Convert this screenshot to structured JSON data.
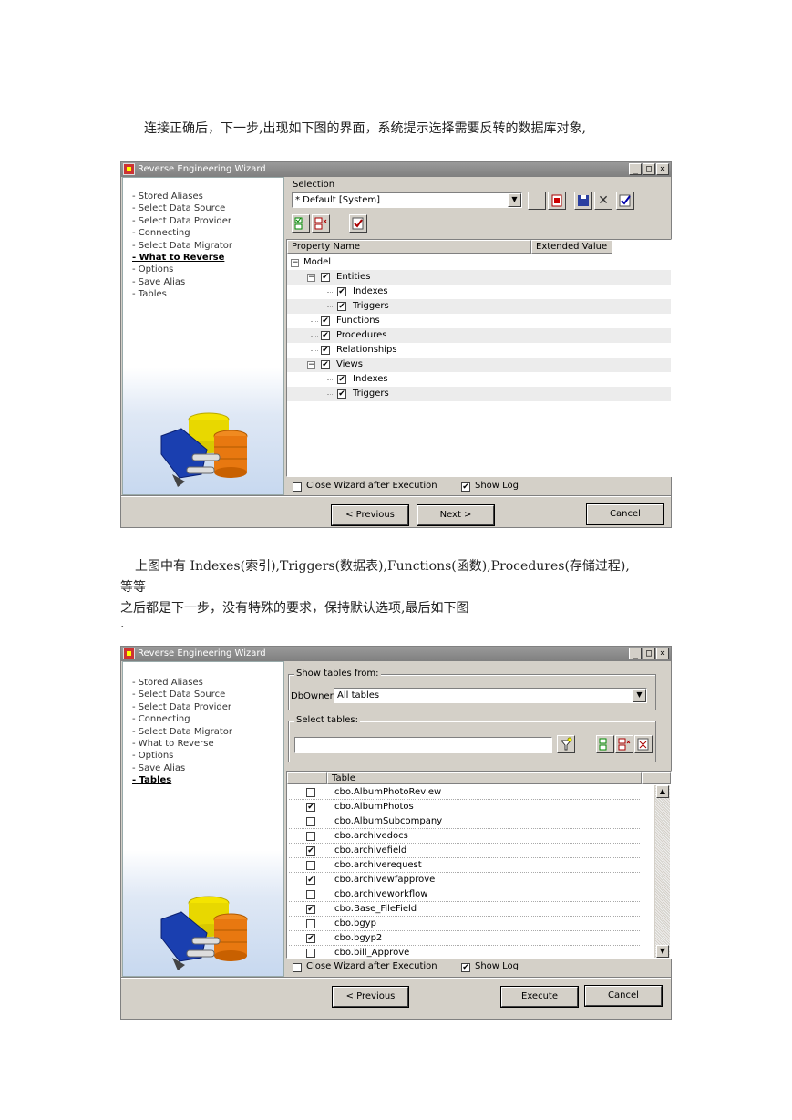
{
  "doc": {
    "para1": "连接正确后，下一步,出现如下图的界面，系统提示选择需要反转的数据库对象,",
    "para2_line1": "上图中有 Indexes(索引),Triggers(数据表),Functions(函数),Procedures(存储过程),",
    "para2_line2": "等等",
    "para3": "之后都是下一步，没有特殊的要求，保持默认选项,最后如下图",
    "para4": "."
  },
  "wizard1": {
    "title": "Reverse Engineering Wizard",
    "steps": [
      "- Stored Aliases",
      "- Select Data Source",
      "- Select Data Provider",
      "- Connecting",
      "- Select Data Migrator",
      "- What to Reverse",
      "- Options",
      "- Save Alias",
      "- Tables"
    ],
    "active_step": "- What to Reverse",
    "selection_label": "Selection",
    "selection_value": "* Default [System]",
    "col_property": "Property Name",
    "col_extended": "Extended Value",
    "tree": [
      {
        "label": "Model",
        "level": 0,
        "toggle": "-",
        "checked": null
      },
      {
        "label": "Entities",
        "level": 1,
        "toggle": "-",
        "checked": true
      },
      {
        "label": "Indexes",
        "level": 2,
        "toggle": null,
        "checked": true
      },
      {
        "label": "Triggers",
        "level": 2,
        "toggle": null,
        "checked": true
      },
      {
        "label": "Functions",
        "level": 1,
        "toggle": null,
        "checked": true
      },
      {
        "label": "Procedures",
        "level": 1,
        "toggle": null,
        "checked": true
      },
      {
        "label": "Relationships",
        "level": 1,
        "toggle": null,
        "checked": true
      },
      {
        "label": "Views",
        "level": 1,
        "toggle": "-",
        "checked": true
      },
      {
        "label": "Indexes",
        "level": 2,
        "toggle": null,
        "checked": true
      },
      {
        "label": "Triggers",
        "level": 2,
        "toggle": null,
        "checked": true
      }
    ],
    "close_wizard_label": "Close Wizard after Execution",
    "close_wizard_checked": false,
    "show_log_label": "Show Log",
    "show_log_checked": true,
    "previous_label": "< Previous",
    "next_label": "Next >",
    "cancel_label": "Cancel"
  },
  "wizard2": {
    "title": "Reverse Engineering Wizard",
    "steps": [
      "- Stored Aliases",
      "- Select Data Source",
      "- Select Data Provider",
      "- Connecting",
      "- Select Data Migrator",
      "- What to Reverse",
      "- Options",
      "- Save Alias",
      "- Tables"
    ],
    "active_step": "- Tables",
    "show_tables_from": "Show tables from:",
    "dbowner_label": "DbOwner:",
    "dbowner_value": "All tables",
    "select_tables": "Select tables:",
    "filter_value": "",
    "col_table": "Table",
    "tables": [
      {
        "name": "cbo.AlbumPhotoReview",
        "checked": false
      },
      {
        "name": "cbo.AlbumPhotos",
        "checked": true
      },
      {
        "name": "cbo.AlbumSubcompany",
        "checked": false
      },
      {
        "name": "cbo.archivedocs",
        "checked": false
      },
      {
        "name": "cbo.archivefield",
        "checked": true
      },
      {
        "name": "cbo.archiverequest",
        "checked": false
      },
      {
        "name": "cbo.archivewfapprove",
        "checked": true
      },
      {
        "name": "cbo.archiveworkflow",
        "checked": false
      },
      {
        "name": "cbo.Base_FileField",
        "checked": true
      },
      {
        "name": "cbo.bgyp",
        "checked": false
      },
      {
        "name": "cbo.bgyp2",
        "checked": true
      },
      {
        "name": "cbo.bill_Approve",
        "checked": false
      }
    ],
    "close_wizard_label": "Close Wizard after Execution",
    "close_wizard_checked": false,
    "show_log_label": "Show Log",
    "show_log_checked": true,
    "previous_label": "< Previous",
    "execute_label": "Execute",
    "cancel_label": "Cancel"
  }
}
